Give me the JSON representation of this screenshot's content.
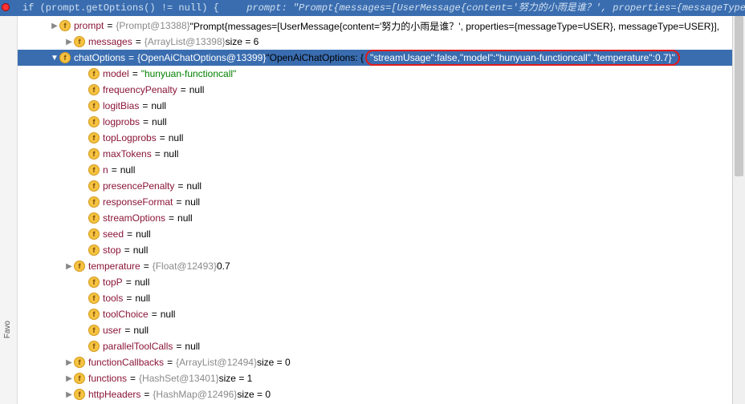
{
  "topbar": {
    "code": "if (prompt.getOptions() != null) {",
    "inlay_label": "prompt: ",
    "inlay_value": "\"Prompt{messages=[UserMessage{content='努力的小雨是谁？', properties={messageType=USER}, messageType=USER}], A"
  },
  "rows": [
    {
      "indent": 36,
      "arrow": ">",
      "name": "prompt",
      "gray": "{Prompt@13388}",
      "rest_plain": " \"Prompt{messages=[UserMessage{content='努力的小雨是谁？', properties={messageType=USER}, messageType=USER}],"
    },
    {
      "indent": 54,
      "arrow": ">",
      "name": "messages",
      "gray": "{ArrayList@13398}",
      "size": "  size = 6",
      "size_val_color": "plain"
    },
    {
      "indent": 36,
      "arrow": "v",
      "selected": true,
      "name": "chatOptions",
      "gray": "{OpenAiChatOptions@13399}",
      "rest_plain": " \"OpenAiChatOptions: {",
      "highlight": "\"streamUsage\":false,\"model\":\"hunyuan-functioncall\",\"temperature\":0.7}\""
    },
    {
      "indent": 72,
      "arrow": "",
      "name": "model",
      "val_str": "\"hunyuan-functioncall\""
    },
    {
      "indent": 72,
      "arrow": "",
      "name": "frequencyPenalty",
      "val_null": "null"
    },
    {
      "indent": 72,
      "arrow": "",
      "name": "logitBias",
      "val_null": "null"
    },
    {
      "indent": 72,
      "arrow": "",
      "name": "logprobs",
      "val_null": "null"
    },
    {
      "indent": 72,
      "arrow": "",
      "name": "topLogprobs",
      "val_null": "null"
    },
    {
      "indent": 72,
      "arrow": "",
      "name": "maxTokens",
      "val_null": "null"
    },
    {
      "indent": 72,
      "arrow": "",
      "name": "n",
      "val_null": "null"
    },
    {
      "indent": 72,
      "arrow": "",
      "name": "presencePenalty",
      "val_null": "null"
    },
    {
      "indent": 72,
      "arrow": "",
      "name": "responseFormat",
      "val_null": "null"
    },
    {
      "indent": 72,
      "arrow": "",
      "name": "streamOptions",
      "val_null": "null"
    },
    {
      "indent": 72,
      "arrow": "",
      "name": "seed",
      "val_null": "null"
    },
    {
      "indent": 72,
      "arrow": "",
      "name": "stop",
      "val_null": "null"
    },
    {
      "indent": 54,
      "arrow": ">",
      "name": "temperature",
      "gray": "{Float@12493}",
      "rest_plain": " 0.7"
    },
    {
      "indent": 72,
      "arrow": "",
      "name": "topP",
      "val_null": "null"
    },
    {
      "indent": 72,
      "arrow": "",
      "name": "tools",
      "val_null": "null"
    },
    {
      "indent": 72,
      "arrow": "",
      "name": "toolChoice",
      "val_null": "null"
    },
    {
      "indent": 72,
      "arrow": "",
      "name": "user",
      "val_null": "null"
    },
    {
      "indent": 72,
      "arrow": "",
      "name": "parallelToolCalls",
      "val_null": "null"
    },
    {
      "indent": 54,
      "arrow": ">",
      "name": "functionCallbacks",
      "gray": "{ArrayList@12494}",
      "size": "  size = 0"
    },
    {
      "indent": 54,
      "arrow": ">",
      "name": "functions",
      "gray": "{HashSet@13401}",
      "size": "  size = 1"
    },
    {
      "indent": 54,
      "arrow": ">",
      "name": "httpHeaders",
      "gray": "{HashMap@12496}",
      "size": "  size = 0"
    }
  ],
  "leftStrip": "Favo"
}
